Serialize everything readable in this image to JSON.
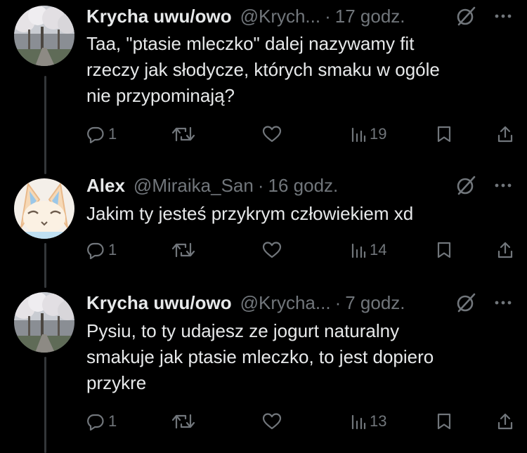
{
  "tweets": [
    {
      "name": "Krycha uwu/owo",
      "handle": "@Krych...",
      "separator": "·",
      "time": "17 godz.",
      "text_lines": [
        "Taa, \"ptasie mleczko\" dalej nazywamy fit",
        "rzeczy jak słodycze, których smaku w ogóle",
        "nie przypominają?"
      ],
      "replies": "1",
      "views": "19"
    },
    {
      "name": "Alex",
      "handle": "@Miraika_San",
      "separator": "·",
      "time": "16 godz.",
      "text_lines": [
        "Jakim ty jesteś przykrym człowiekiem xd"
      ],
      "replies": "1",
      "views": "14"
    },
    {
      "name": "Krycha uwu/owo",
      "handle": "@Krycha...",
      "separator": "·",
      "time": "7 godz.",
      "text_lines": [
        "Pysiu, to ty udajesz ze jogurt naturalny",
        "smakuje jak ptasie mleczko, to jest dopiero",
        "przykre"
      ],
      "replies": "1",
      "views": "13"
    }
  ],
  "icons": {
    "reply": "reply-icon",
    "retweet": "retweet-icon",
    "like": "heart-icon",
    "views": "views-icon",
    "bookmark": "bookmark-icon",
    "share": "share-icon",
    "grok": "grok-icon",
    "more": "more-icon"
  },
  "colors": {
    "background": "#000000",
    "text_primary": "#e7e9ea",
    "text_secondary": "#71767b",
    "thread_line": "#333639"
  }
}
